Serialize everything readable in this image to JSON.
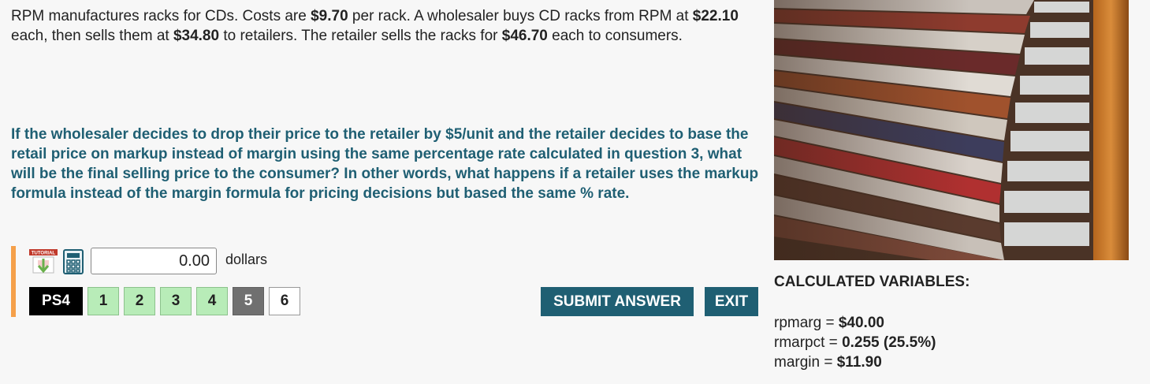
{
  "intro": {
    "t1": "RPM manufactures racks for CDs. Costs are ",
    "cost": "$9.70",
    "t2": " per rack. A wholesaler buys CD racks from RPM at ",
    "wholesale_cost": "$22.10",
    "t3": " each, then sells them at ",
    "wholesale_price": "$34.80",
    "t4": " to retailers. The retailer sells the racks for ",
    "retail_price": "$46.70",
    "t5": " each to consumers."
  },
  "question": "If the wholesaler decides to drop their price to the retailer by $5/unit and the retailer decides to base the retail price on markup instead of margin using the same percentage rate calculated in question 3, what will be the final selling price to the consumer?  In other words, what happens if a retailer uses the markup formula instead of the margin formula for pricing decisions but based the same % rate.",
  "answer": {
    "value": "0.00",
    "units": "dollars",
    "tutorial_label": "TUTORIAL"
  },
  "nav": {
    "ps_label": "PS4",
    "parts": [
      {
        "label": "1",
        "state": "done"
      },
      {
        "label": "2",
        "state": "done"
      },
      {
        "label": "3",
        "state": "done"
      },
      {
        "label": "4",
        "state": "done"
      },
      {
        "label": "5",
        "state": "current"
      },
      {
        "label": "6",
        "state": "todo"
      }
    ],
    "submit_label": "SUBMIT ANSWER",
    "exit_label": "EXIT"
  },
  "calculated": {
    "title": "CALCULATED VARIABLES:",
    "vars": [
      {
        "name": "rpmarg",
        "value": "$40.00"
      },
      {
        "name": "rmarpct",
        "value": "0.255 (25.5%)"
      },
      {
        "name": "margin",
        "value": "$11.90"
      }
    ]
  },
  "colors": {
    "accent": "#1f5f73",
    "answer_bar": "#f5a04a",
    "done_part": "#b8ecb8",
    "current_part": "#707070"
  }
}
